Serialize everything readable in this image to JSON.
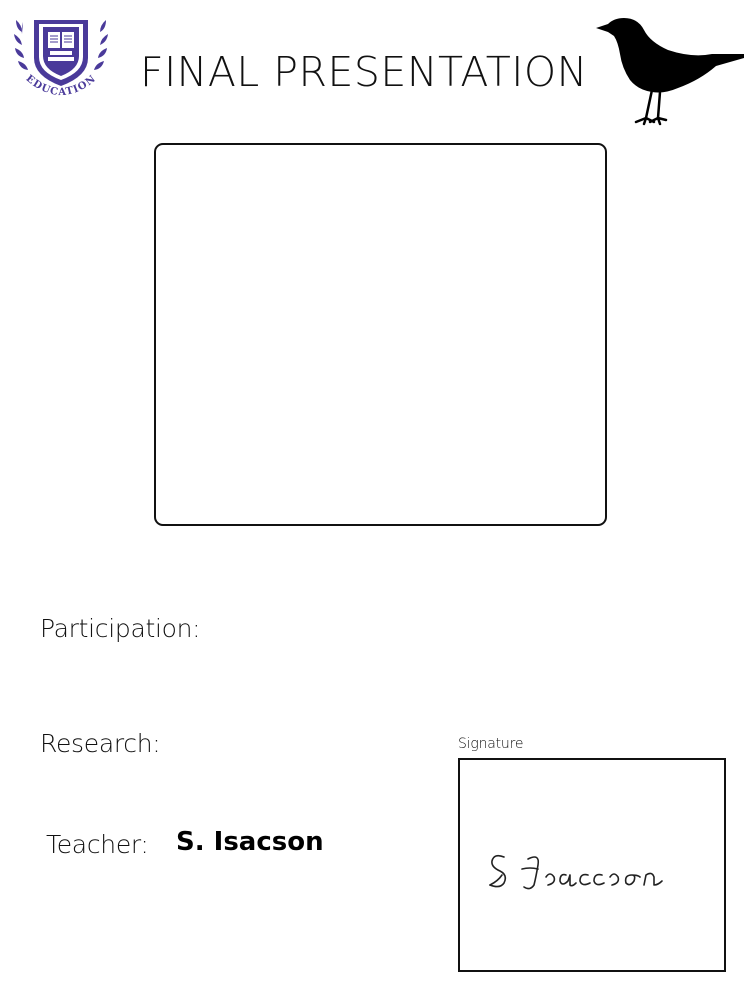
{
  "logo": {
    "icon": "education-crest-icon",
    "text": "EDUCATION",
    "color": "#4a3a9a"
  },
  "header": {
    "title": "FINAL PRESENTATION",
    "bird_icon": "blackbird-silhouette-icon"
  },
  "photo": {
    "placeholder_icon": "empty-photo-frame"
  },
  "fields": {
    "participation_label": "Participation:",
    "research_label": "Research:",
    "teacher_label": "Teacher:",
    "teacher_name": "S. Isacson"
  },
  "signature": {
    "label": "Signature",
    "signed_name": "S Isaccson"
  }
}
